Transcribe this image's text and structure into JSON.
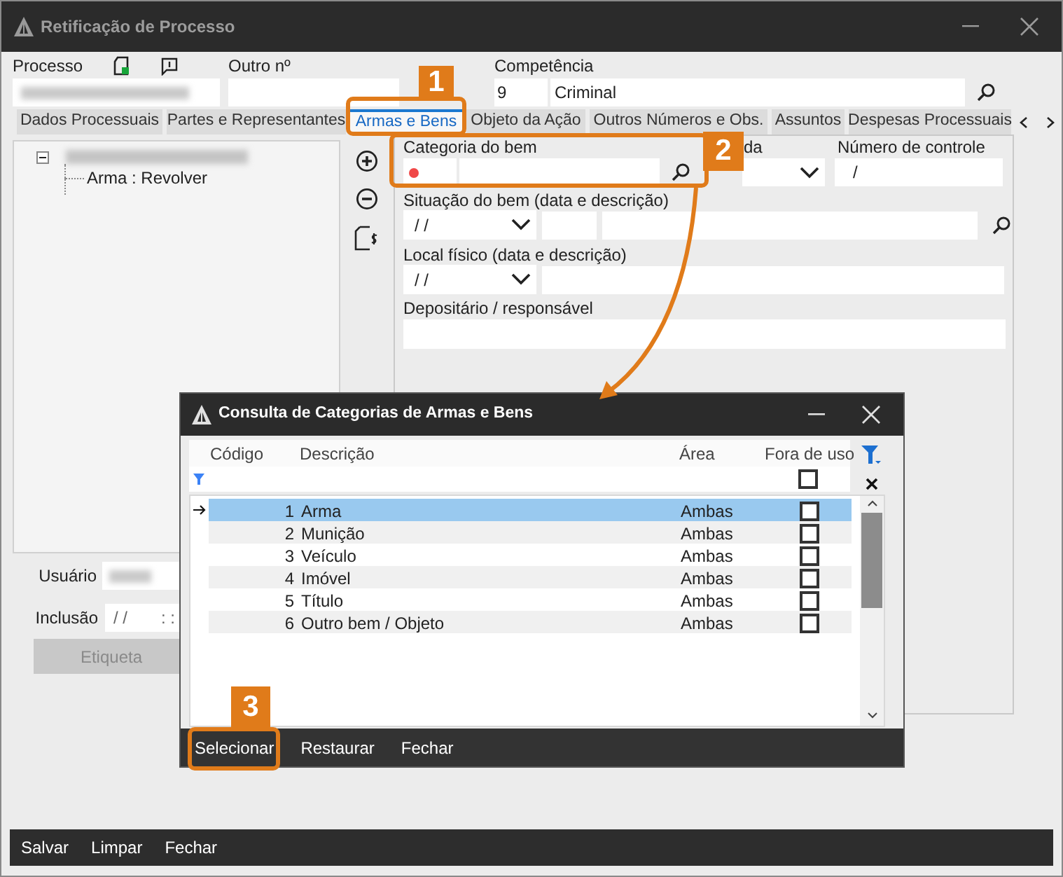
{
  "window": {
    "title": "Retificação de Processo"
  },
  "header": {
    "processo_label": "Processo",
    "outro_label": "Outro nº",
    "competencia_label": "Competência",
    "competencia_code": "9",
    "competencia_name": "Criminal"
  },
  "tabs": [
    {
      "label": "Dados Processuais",
      "selected": false
    },
    {
      "label": "Partes e Representantes",
      "selected": false
    },
    {
      "label": "Armas e Bens",
      "selected": true
    },
    {
      "label": "Objeto da Ação",
      "selected": false
    },
    {
      "label": "Outros Números e Obs.",
      "selected": false
    },
    {
      "label": "Assuntos",
      "selected": false
    },
    {
      "label": "Despesas Processuais",
      "selected": false
    }
  ],
  "tree": {
    "expanded": true,
    "children": [
      {
        "label": "Arma : Revolver"
      }
    ]
  },
  "form": {
    "categoria_label": "Categoria do bem",
    "data_label": "da",
    "controle_label": "Número de controle",
    "controle_value": "/",
    "situacao_label": "Situação do bem (data e descrição)",
    "situacao_date": "/ /",
    "local_label": "Local físico (data e descrição)",
    "local_date": "/ /",
    "depositario_label": "Depositário / responsável"
  },
  "record": {
    "usuario_label": "Usuário",
    "inclusao_label": "Inclusão",
    "inclusao_date": "/ /",
    "inclusao_time": ": :",
    "etiqueta": {
      "label": "Etiqueta",
      "disabled": true
    }
  },
  "dialog": {
    "title": "Consulta de Categorias de Armas e Bens",
    "columns": [
      "Código",
      "Descrição",
      "Área",
      "Fora de uso"
    ],
    "filter_out_of_use": false,
    "rows": [
      {
        "code": "1",
        "description": "Arma",
        "area": "Ambas",
        "out_of_use": false,
        "selected": true
      },
      {
        "code": "2",
        "description": "Munição",
        "area": "Ambas",
        "out_of_use": false,
        "selected": false
      },
      {
        "code": "3",
        "description": "Veículo",
        "area": "Ambas",
        "out_of_use": false,
        "selected": false
      },
      {
        "code": "4",
        "description": "Imóvel",
        "area": "Ambas",
        "out_of_use": false,
        "selected": false
      },
      {
        "code": "5",
        "description": "Título",
        "area": "Ambas",
        "out_of_use": false,
        "selected": false
      },
      {
        "code": "6",
        "description": "Outro bem / Objeto",
        "area": "Ambas",
        "out_of_use": false,
        "selected": false
      }
    ],
    "buttons": [
      "Selecionar",
      "Restaurar",
      "Fechar"
    ]
  },
  "footer_buttons": [
    "Salvar",
    "Limpar",
    "Fechar"
  ],
  "callouts": [
    {
      "number": "1"
    },
    {
      "number": "2"
    },
    {
      "number": "3"
    }
  ]
}
